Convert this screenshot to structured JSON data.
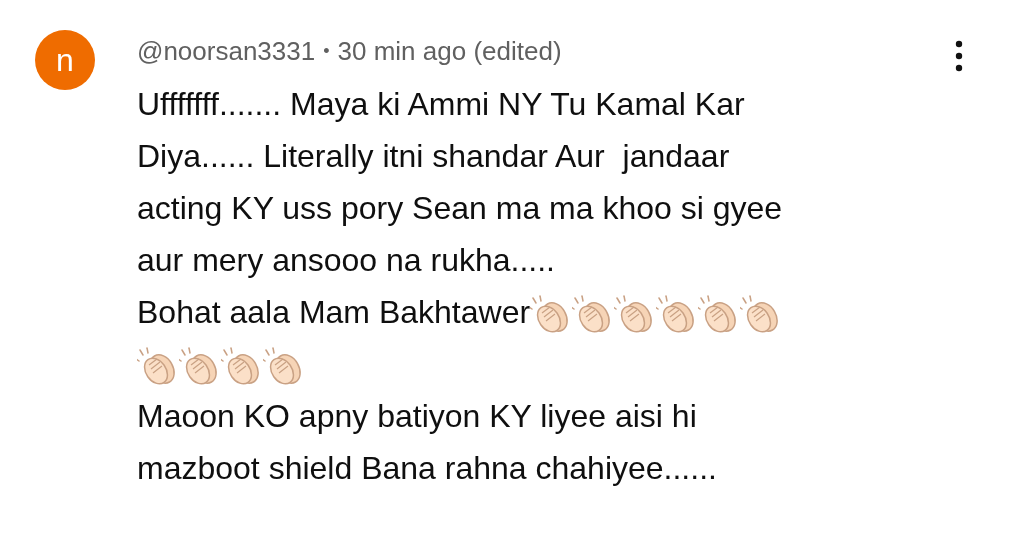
{
  "comment": {
    "avatar_letter": "n",
    "author": "@noorsan3331",
    "separator": "•",
    "time": "30 min ago (edited)",
    "lines": [
      {
        "text": "Ufffffff....... Maya ki Ammi NY Tu Kamal Kar"
      },
      {
        "text": "Diya...... Literally itni shandar Aur  jandaar"
      },
      {
        "text": "acting KY uss pory Sean ma ma khoo si gyee"
      },
      {
        "text": "aur mery ansooo na rukha....."
      },
      {
        "text": "Bohat aala Mam Bakhtawer",
        "emoji": [
          {
            "kind": "clap"
          },
          {
            "kind": "clap"
          },
          {
            "kind": "clap"
          },
          {
            "kind": "clap"
          },
          {
            "kind": "clap"
          },
          {
            "kind": "clap"
          }
        ]
      },
      {
        "emoji": [
          {
            "kind": "clap"
          },
          {
            "kind": "clap"
          },
          {
            "kind": "clap"
          },
          {
            "kind": "clap"
          }
        ]
      },
      {
        "text": "Maoon KO apny batiyon KY liyee aisi hi"
      },
      {
        "text": "mazboot shield Bana rahna chahiyee......"
      }
    ]
  }
}
